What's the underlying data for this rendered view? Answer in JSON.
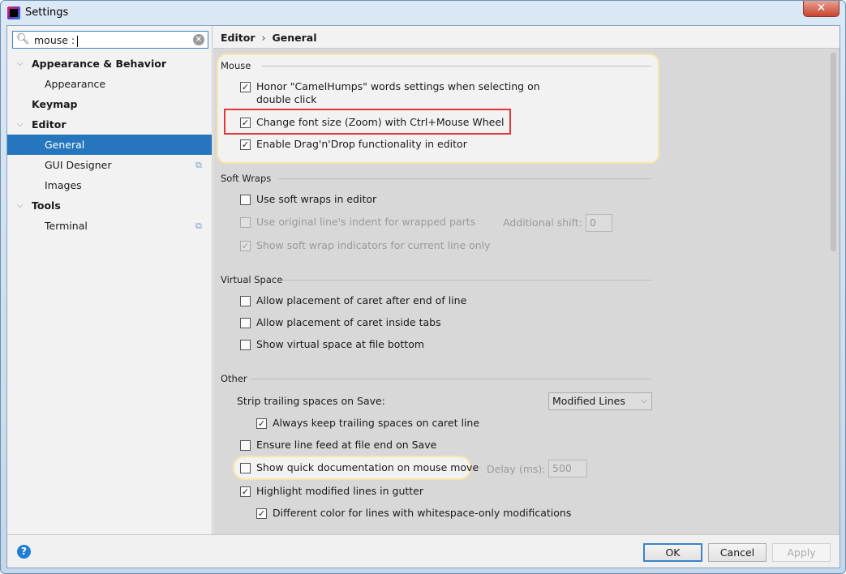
{
  "window": {
    "title": "Settings",
    "close_icon": "close-icon"
  },
  "search": {
    "value": "mouse :",
    "icon": "search-icon"
  },
  "sidebar": {
    "items": [
      {
        "label": "Appearance & Behavior",
        "level": 0,
        "expanded": true
      },
      {
        "label": "Appearance",
        "level": 1
      },
      {
        "label": "Keymap",
        "level": 0
      },
      {
        "label": "Editor",
        "level": 0,
        "expanded": true
      },
      {
        "label": "General",
        "level": 1,
        "selected": true
      },
      {
        "label": "GUI Designer",
        "level": 1,
        "project_icon": true
      },
      {
        "label": "Images",
        "level": 1
      },
      {
        "label": "Tools",
        "level": 0,
        "expanded": true
      },
      {
        "label": "Terminal",
        "level": 1,
        "project_icon": true
      }
    ]
  },
  "breadcrumb": {
    "parent": "Editor",
    "separator": "›",
    "current": "General"
  },
  "sections": {
    "mouse": {
      "title": "Mouse",
      "items": [
        {
          "label": "Honor \"CamelHumps\" words settings when selecting on",
          "label2": "double click",
          "checked": true
        },
        {
          "label": "Change font size (Zoom) with Ctrl+Mouse Wheel",
          "checked": true
        },
        {
          "label": "Enable Drag'n'Drop functionality in editor",
          "checked": true
        }
      ]
    },
    "soft_wraps": {
      "title": "Soft Wraps",
      "items": [
        {
          "label": "Use soft wraps in editor",
          "checked": false
        },
        {
          "label": "Use original line's indent for wrapped parts",
          "checked": false,
          "disabled": true
        },
        {
          "label": "Show soft wrap indicators for current line only",
          "checked": true,
          "disabled": true
        }
      ],
      "additional_shift_label": "Additional shift:",
      "additional_shift_value": "0"
    },
    "virtual_space": {
      "title": "Virtual Space",
      "items": [
        {
          "label": "Allow placement of caret after end of line",
          "checked": false
        },
        {
          "label": "Allow placement of caret inside tabs",
          "checked": false
        },
        {
          "label": "Show virtual space at file bottom",
          "checked": false
        }
      ]
    },
    "other": {
      "title": "Other",
      "strip_label": "Strip trailing spaces on Save:",
      "strip_value": "Modified Lines",
      "items": [
        {
          "label": "Always keep trailing spaces on caret line",
          "checked": true
        },
        {
          "label": "Ensure line feed at file end on Save",
          "checked": false
        },
        {
          "label": "Show quick documentation on mouse move",
          "checked": false
        },
        {
          "label": "Highlight modified lines in gutter",
          "checked": true
        },
        {
          "label": "Different color for lines with whitespace-only modifications",
          "checked": true
        }
      ],
      "delay_label": "Delay (ms):",
      "delay_value": "500"
    }
  },
  "footer": {
    "ok": "OK",
    "cancel": "Cancel",
    "apply": "Apply",
    "help": "?"
  },
  "colors": {
    "selection": "#2675bf",
    "highlight_border": "#f6e6a8",
    "annotation_red": "#e0363c"
  }
}
